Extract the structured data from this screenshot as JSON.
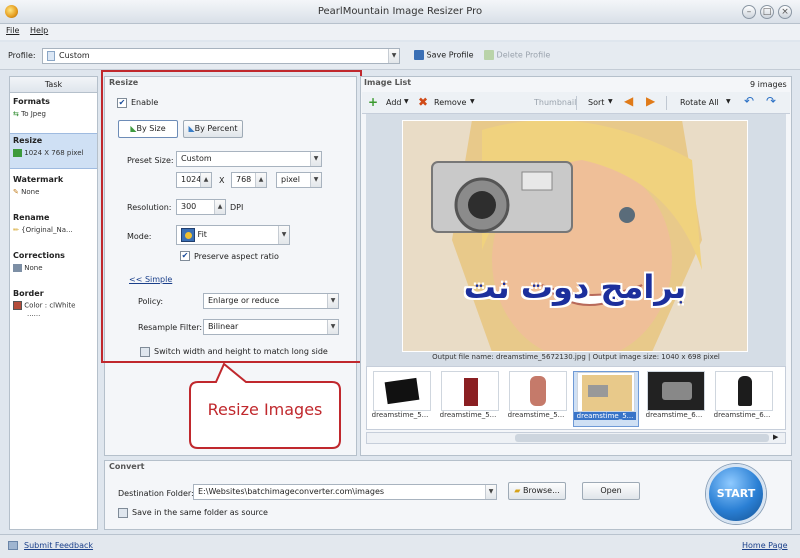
{
  "window": {
    "title": "PearlMountain Image Resizer Pro"
  },
  "menu": {
    "file": "File",
    "help": "Help"
  },
  "profile": {
    "label": "Profile:",
    "value": "Custom",
    "save_label": "Save Profile",
    "delete_label": "Delete Profile"
  },
  "task": {
    "header": "Task",
    "items": [
      {
        "title": "Formats",
        "value": "To Jpeg"
      },
      {
        "title": "Resize",
        "value": "1024 X 768 pixel"
      },
      {
        "title": "Watermark",
        "value": "None"
      },
      {
        "title": "Rename",
        "value": "{Original_Na..."
      },
      {
        "title": "Corrections",
        "value": "None"
      },
      {
        "title": "Border",
        "value": "Color : clWhite",
        "value2": "......"
      }
    ]
  },
  "resize": {
    "title": "Resize",
    "enable_label": "Enable",
    "by_size_label": "By Size",
    "by_percent_label": "By Percent",
    "preset_label": "Preset Size:",
    "preset_value": "Custom",
    "width": "1024",
    "x_label": "X",
    "height": "768",
    "unit": "pixel",
    "resolution_label": "Resolution:",
    "resolution_value": "300",
    "dpi_label": "DPI",
    "mode_label": "Mode:",
    "mode_value": "Fit",
    "preserve_label": "Preserve aspect ratio",
    "simple_link": "<< Simple",
    "policy_label": "Policy:",
    "policy_value": "Enlarge or reduce",
    "resample_label": "Resample Filter:",
    "resample_value": "Bilinear",
    "switch_label": "Switch width and height to match long side"
  },
  "callout": {
    "text": "Resize Images"
  },
  "watermark_text": "برامج دوت نت",
  "image_list": {
    "title": "Image List",
    "count": "9 images",
    "add_label": "Add",
    "remove_label": "Remove",
    "thumbnail_label": "Thumbnail",
    "sort_label": "Sort",
    "rotate_label": "Rotate All",
    "output_info": "Output file name: dreamstime_5672130.jpg | Output image size: 1040 x 698 pixel",
    "thumbnails": [
      {
        "label": "dreamstime_5..."
      },
      {
        "label": "dreamstime_5..."
      },
      {
        "label": "dreamstime_5..."
      },
      {
        "label": "dreamstime_5..."
      },
      {
        "label": "dreamstime_6..."
      },
      {
        "label": "dreamstime_6..."
      }
    ]
  },
  "convert": {
    "title": "Convert",
    "dest_label": "Destination Folder:",
    "dest_value": "E:\\Websites\\batchimageconverter.com\\images",
    "browse_label": "Browse...",
    "open_label": "Open",
    "same_folder_label": "Save in the same folder as source",
    "start_label": "START"
  },
  "status": {
    "feedback": "Submit Feedback",
    "home": "Home Page"
  },
  "colors": {
    "accent_red": "#c0282d",
    "start_blue": "#2a7fd4",
    "panel_bg": "#f4f6f9"
  }
}
